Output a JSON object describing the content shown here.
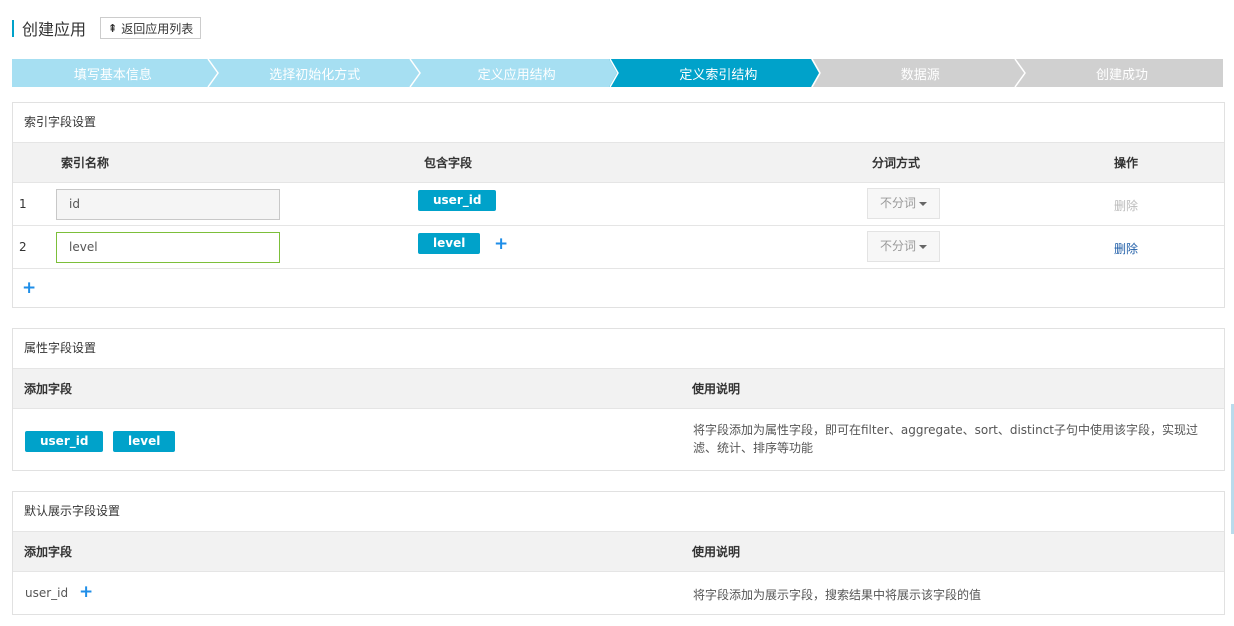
{
  "header": {
    "title": "创建应用",
    "back_label": "返回应用列表",
    "back_arrow": "⇞"
  },
  "steps": [
    {
      "label": "填写基本信息",
      "state": "done"
    },
    {
      "label": "选择初始化方式",
      "state": "done"
    },
    {
      "label": "定义应用结构",
      "state": "done"
    },
    {
      "label": "定义索引结构",
      "state": "active"
    },
    {
      "label": "数据源",
      "state": "todo"
    },
    {
      "label": "创建成功",
      "state": "todo"
    }
  ],
  "index_panel": {
    "title": "索引字段设置",
    "columns": [
      "索引名称",
      "包含字段",
      "分词方式",
      "操作"
    ],
    "rows": [
      {
        "num": "1",
        "name": "id",
        "field": "user_id",
        "tokenize": "不分词",
        "action": "删除"
      },
      {
        "num": "2",
        "name": "level",
        "field": "level",
        "tokenize": "不分词",
        "action": "删除"
      }
    ]
  },
  "attr_panel": {
    "title": "属性字段设置",
    "columns": [
      "添加字段",
      "使用说明"
    ],
    "tags": [
      "user_id",
      "level"
    ],
    "description": "将字段添加为属性字段，即可在filter、aggregate、sort、distinct子句中使用该字段，实现过滤、统计、排序等功能"
  },
  "display_panel": {
    "title": "默认展示字段设置",
    "columns": [
      "添加字段",
      "使用说明"
    ],
    "field": "user_id",
    "description": "将字段添加为展示字段，搜索结果中将展示该字段的值"
  },
  "colors": {
    "accent": "#00a2ca",
    "step_done": "#a6dff2",
    "step_todo": "#d0d0d0",
    "link": "#1f5ea8",
    "plus": "#1f8ee8"
  }
}
